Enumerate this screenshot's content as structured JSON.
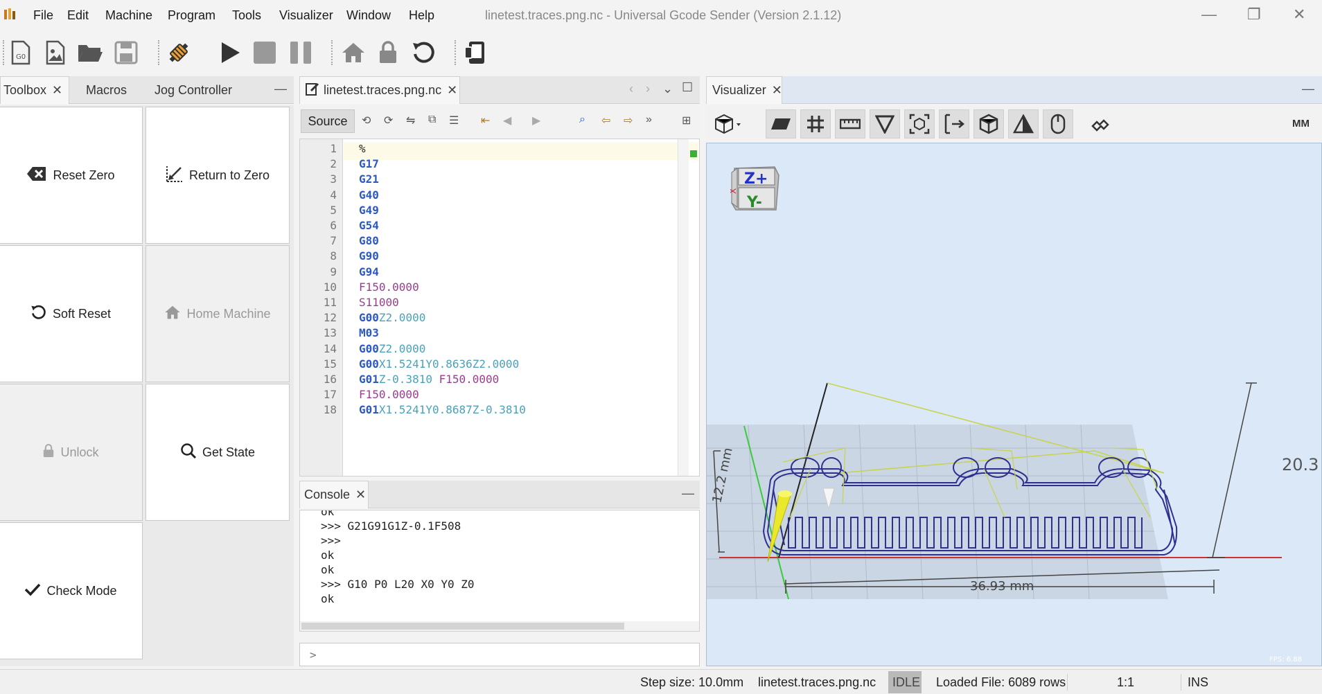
{
  "app": {
    "title": "linetest.traces.png.nc - Universal Gcode Sender (Version 2.1.12)"
  },
  "menu": [
    "File",
    "Edit",
    "Machine",
    "Program",
    "Tools",
    "Visualizer",
    "Window",
    "Help"
  ],
  "toolbar": {
    "icons": [
      "new-gcode-icon",
      "new-image-icon",
      "open-folder-icon",
      "save-icon",
      "connect-icon",
      "play-icon",
      "stop-icon",
      "pause-icon",
      "home-icon",
      "lock-icon",
      "reset-icon",
      "machine-status-icon"
    ]
  },
  "left_tabs": [
    "Toolbox",
    "Macros",
    "Jog Controller"
  ],
  "toolbox": {
    "buttons": [
      {
        "label": "Reset Zero",
        "icon": "backspace-icon",
        "enabled": true
      },
      {
        "label": "Return to Zero",
        "icon": "return-to-zero-icon",
        "enabled": true
      },
      {
        "label": "Soft Reset",
        "icon": "reset-icon",
        "enabled": true
      },
      {
        "label": "Home Machine",
        "icon": "home-icon",
        "enabled": false
      },
      {
        "label": "Unlock",
        "icon": "lock-icon",
        "enabled": false
      },
      {
        "label": "Get State",
        "icon": "search-icon",
        "enabled": true
      },
      {
        "label": "Check Mode",
        "icon": "check-icon",
        "enabled": true
      }
    ]
  },
  "editor": {
    "tab_label": "linetest.traces.png.nc",
    "source_label": "Source",
    "lines": [
      {
        "n": "1",
        "parts": [
          {
            "t": "%",
            "c": "plain"
          }
        ]
      },
      {
        "n": "2",
        "parts": [
          {
            "t": "G17",
            "c": "kw"
          }
        ]
      },
      {
        "n": "3",
        "parts": [
          {
            "t": "G21",
            "c": "kw"
          }
        ]
      },
      {
        "n": "4",
        "parts": [
          {
            "t": "G40",
            "c": "kw"
          }
        ]
      },
      {
        "n": "5",
        "parts": [
          {
            "t": "G49",
            "c": "kw"
          }
        ]
      },
      {
        "n": "6",
        "parts": [
          {
            "t": "G54",
            "c": "kw"
          }
        ]
      },
      {
        "n": "7",
        "parts": [
          {
            "t": "G80",
            "c": "kw"
          }
        ]
      },
      {
        "n": "8",
        "parts": [
          {
            "t": "G90",
            "c": "kw"
          }
        ]
      },
      {
        "n": "9",
        "parts": [
          {
            "t": "G94",
            "c": "kw"
          }
        ]
      },
      {
        "n": "10",
        "parts": [
          {
            "t": "F150.0000",
            "c": "feed"
          }
        ]
      },
      {
        "n": "11",
        "parts": [
          {
            "t": "S11000",
            "c": "feed"
          }
        ]
      },
      {
        "n": "12",
        "parts": [
          {
            "t": "G00",
            "c": "kw"
          },
          {
            "t": "Z2.0000",
            "c": "num"
          }
        ]
      },
      {
        "n": "13",
        "parts": [
          {
            "t": "M03",
            "c": "kw"
          }
        ]
      },
      {
        "n": "14",
        "parts": [
          {
            "t": "G00",
            "c": "kw"
          },
          {
            "t": "Z2.0000",
            "c": "num"
          }
        ]
      },
      {
        "n": "15",
        "parts": [
          {
            "t": "G00",
            "c": "kw"
          },
          {
            "t": "X1.5241Y0.8636Z2.0000",
            "c": "num"
          }
        ]
      },
      {
        "n": "16",
        "parts": [
          {
            "t": "G01",
            "c": "kw"
          },
          {
            "t": "Z-0.3810 ",
            "c": "num"
          },
          {
            "t": "F150.0000",
            "c": "feed"
          }
        ]
      },
      {
        "n": "17",
        "parts": [
          {
            "t": "F150.0000",
            "c": "feed"
          }
        ]
      },
      {
        "n": "18",
        "parts": [
          {
            "t": "G01",
            "c": "kw"
          },
          {
            "t": "X1.5241Y0.8687Z-0.3810",
            "c": "num"
          }
        ]
      }
    ]
  },
  "console": {
    "tab_label": "Console",
    "lines": [
      "ok",
      ">>> G21G91G1Z-0.1F508",
      ">>>",
      "ok",
      "ok",
      ">>> G10 P0 L20 X0 Y0 Z0",
      "ok"
    ],
    "input_placeholder": ">"
  },
  "visualizer": {
    "tab_label": "Visualizer",
    "units": "MM",
    "cube_top": "Z+",
    "cube_front": "Y-",
    "dim_x": "36.93 mm",
    "dim_y": "12.2 mm",
    "dim_z": "20.3",
    "fps": "FPS: 6.88",
    "icons": [
      "view-cube-icon",
      "plane-icon",
      "grid-icon",
      "ruler-icon",
      "triangle-icon",
      "bounding-box-icon",
      "dimension-icon",
      "model-icon",
      "warning-triangle-icon",
      "mouse-icon",
      "plugin-icon"
    ]
  },
  "statusbar": {
    "step_size": "Step size: 10.0mm",
    "file": "linetest.traces.png.nc",
    "state": "IDLE",
    "loaded": "Loaded File: 6089 rows",
    "zoom": "1:1",
    "mode": "INS"
  },
  "colors": {
    "keyword": "#2b58c4",
    "number": "#4aa2b9",
    "feed": "#9b3d8f",
    "viz_bg": "#dbe8f7",
    "toolpath": "#2f2f8f"
  }
}
